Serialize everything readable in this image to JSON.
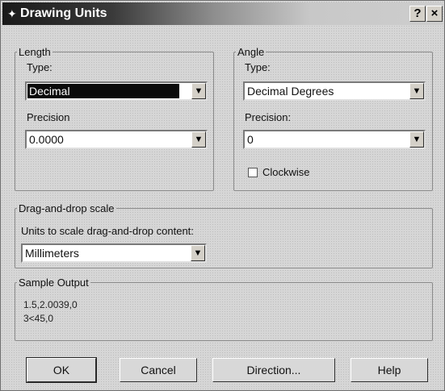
{
  "window": {
    "title": "Drawing Units",
    "help_button": "?",
    "close_button": "×"
  },
  "length": {
    "legend": "Length",
    "type_label": "Type:",
    "type_value": "Decimal",
    "precision_label": "Precision",
    "precision_value": "0.0000"
  },
  "angle": {
    "legend": "Angle",
    "type_label": "Type:",
    "type_value": "Decimal Degrees",
    "precision_label": "Precision:",
    "precision_value": "0",
    "clockwise_label": "Clockwise",
    "clockwise_checked": false
  },
  "drag_drop": {
    "legend": "Drag-and-drop scale",
    "description": "Units to scale drag-and-drop content:",
    "value": "Millimeters"
  },
  "sample_output": {
    "legend": "Sample Output",
    "line1": "1.5,2.0039,0",
    "line2": "3<45,0"
  },
  "buttons": {
    "ok": "OK",
    "cancel": "Cancel",
    "direction": "Direction...",
    "help": "Help"
  }
}
